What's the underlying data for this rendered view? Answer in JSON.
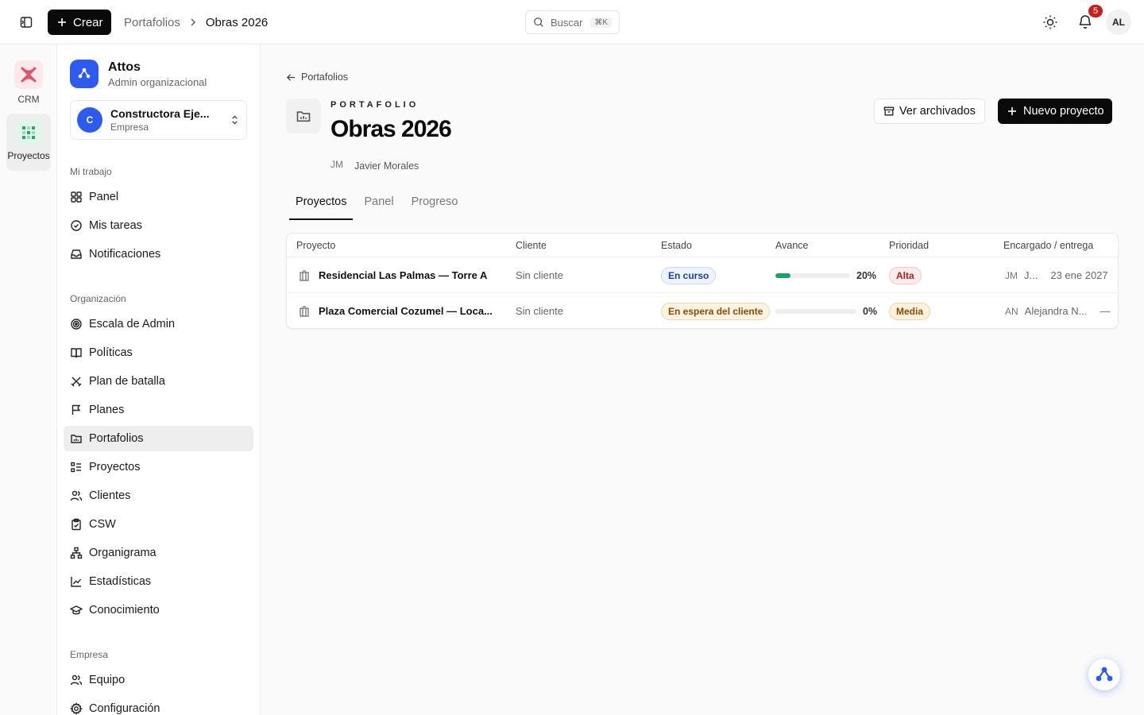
{
  "topbar": {
    "create_label": "Crear",
    "breadcrumb": [
      "Portafolios",
      "Obras 2026"
    ],
    "search_placeholder": "Buscar",
    "search_shortcut": "⌘K",
    "notification_count": "5",
    "user_initials": "AL"
  },
  "rail": {
    "items": [
      {
        "label": "CRM",
        "icon": "crm-icon"
      },
      {
        "label": "Proyectos",
        "icon": "projects-grid-icon"
      }
    ]
  },
  "sidebar": {
    "org_name": "Attos",
    "org_role": "Admin organizacional",
    "company_initial": "C",
    "company_name": "Constructora Eje...",
    "company_type": "Empresa",
    "sections": [
      {
        "title": "Mi trabajo",
        "items": [
          {
            "label": "Panel",
            "icon": "dashboard-icon"
          },
          {
            "label": "Mis tareas",
            "icon": "check-circle-icon"
          },
          {
            "label": "Notificaciones",
            "icon": "inbox-icon"
          }
        ]
      },
      {
        "title": "Organización",
        "items": [
          {
            "label": "Escala de Admin",
            "icon": "target-icon"
          },
          {
            "label": "Políticas",
            "icon": "book-icon"
          },
          {
            "label": "Plan de batalla",
            "icon": "swords-icon"
          },
          {
            "label": "Planes",
            "icon": "flag-icon"
          },
          {
            "label": "Portafolios",
            "icon": "folder-chart-icon",
            "active": true
          },
          {
            "label": "Proyectos",
            "icon": "list-checks-icon"
          },
          {
            "label": "Clientes",
            "icon": "users-icon"
          },
          {
            "label": "CSW",
            "icon": "clipboard-icon"
          },
          {
            "label": "Organigrama",
            "icon": "org-chart-icon"
          },
          {
            "label": "Estadísticas",
            "icon": "line-chart-icon"
          },
          {
            "label": "Conocimiento",
            "icon": "graduation-cap-icon"
          }
        ]
      },
      {
        "title": "Empresa",
        "items": [
          {
            "label": "Equipo",
            "icon": "users-icon"
          },
          {
            "label": "Configuración",
            "icon": "gear-icon"
          }
        ]
      }
    ]
  },
  "main": {
    "back_label": "Portafolios",
    "eyebrow": "PORTAFOLIO",
    "title": "Obras 2026",
    "owner_initials": "JM",
    "owner_name": "Javier Morales",
    "archived_label": "Ver archivados",
    "new_project_label": "Nuevo proyecto",
    "tabs": [
      "Proyectos",
      "Panel",
      "Progreso"
    ],
    "active_tab": "Proyectos",
    "table": {
      "headers": [
        "Proyecto",
        "Cliente",
        "Estado",
        "Avance",
        "Prioridad",
        "Encargado / entrega"
      ],
      "rows": [
        {
          "project": "Residencial Las Palmas — Torre A",
          "client": "Sin cliente",
          "status": "En curso",
          "progress": 20,
          "progress_label": "20%",
          "priority": "Alta",
          "owner_initials": "JM",
          "owner": "J...",
          "due": "23 ene 2027"
        },
        {
          "project": "Plaza Comercial Cozumel — Loca...",
          "client": "Sin cliente",
          "status": "En espera del cliente",
          "progress": 0,
          "progress_label": "0%",
          "priority": "Media",
          "owner_initials": "AN",
          "owner": "Alejandra N...",
          "due": "—"
        }
      ]
    }
  },
  "colors": {
    "brand": "#2d5bf0",
    "primary_button": "#0a0a0a",
    "progress": "#16a36a",
    "badge": "#c81e1e"
  }
}
